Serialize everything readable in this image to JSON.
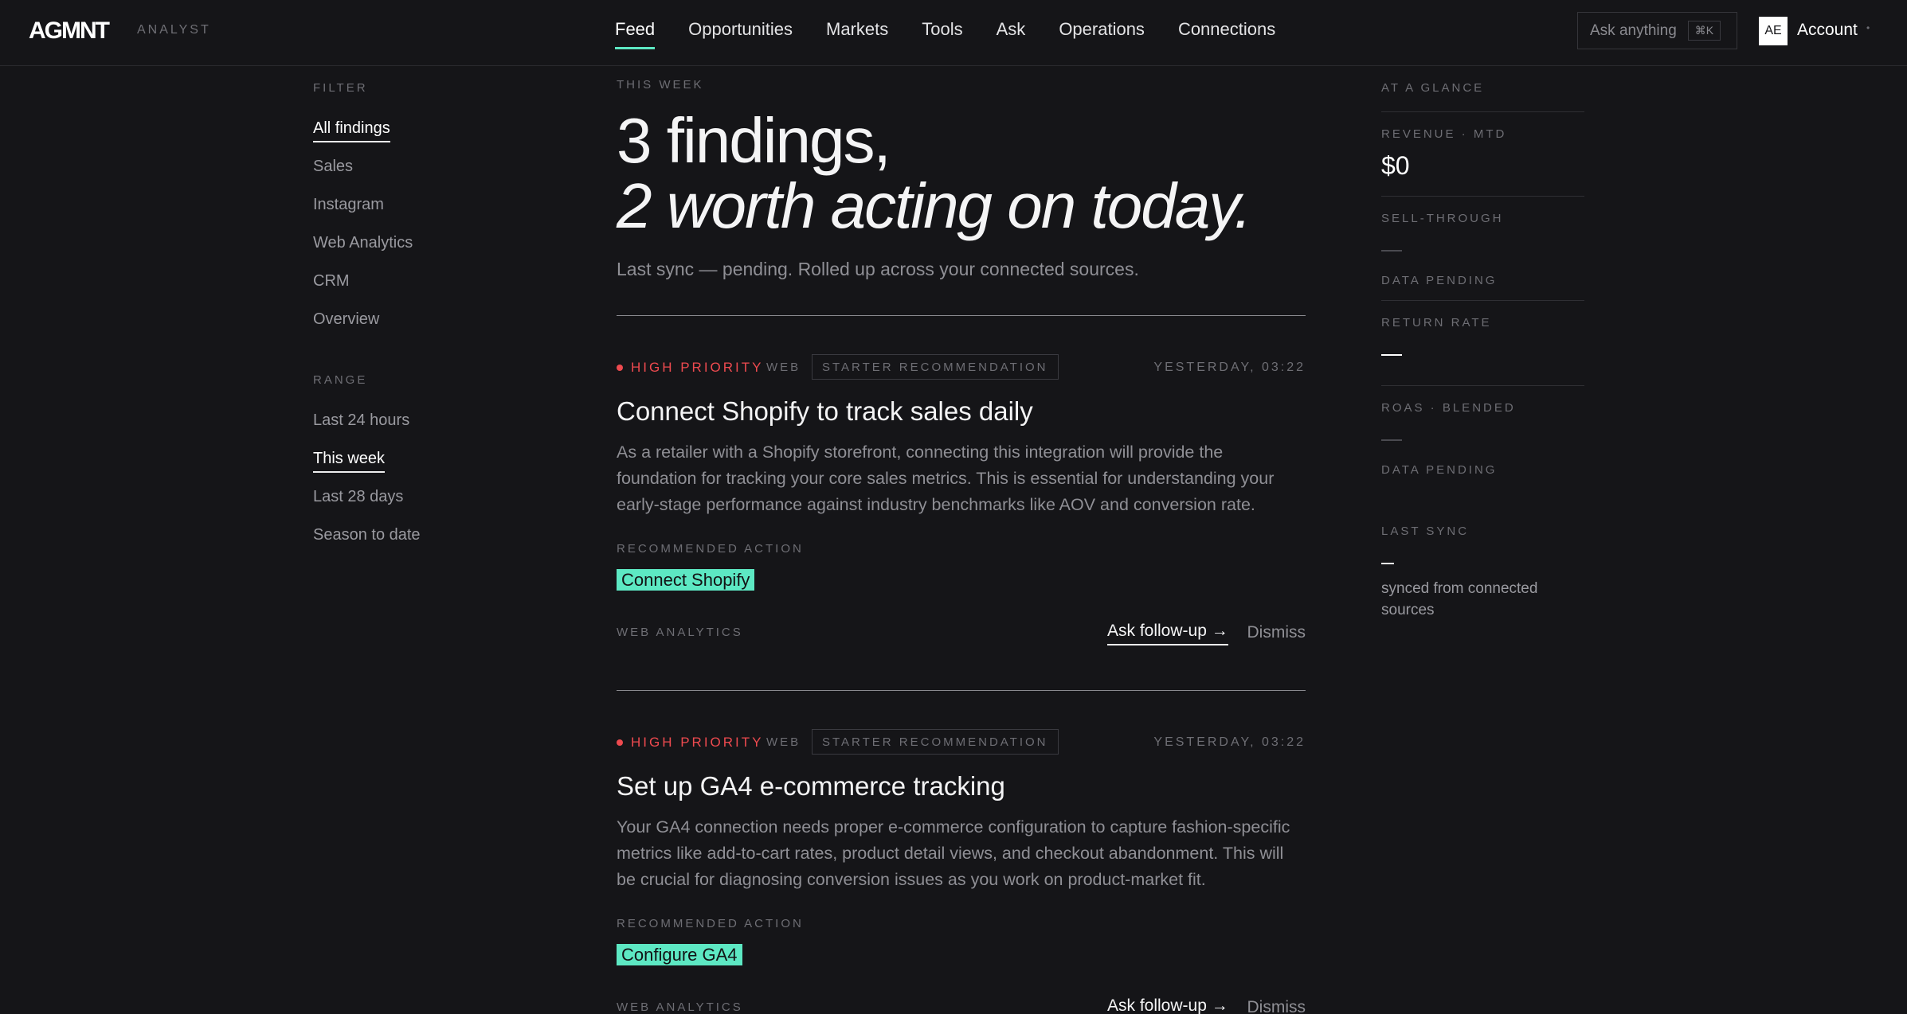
{
  "header": {
    "logo": "AGMNT",
    "logo_sub": "ANALYST",
    "nav": [
      "Feed",
      "Opportunities",
      "Markets",
      "Tools",
      "Ask",
      "Operations",
      "Connections"
    ],
    "active_nav": "Feed",
    "search_placeholder": "Ask anything",
    "search_shortcut": "⌘K",
    "avatar_initials": "AE",
    "account_label": "Account",
    "account_caret": "•"
  },
  "filter": {
    "label": "FILTER",
    "items": [
      "All findings",
      "Sales",
      "Instagram",
      "Web Analytics",
      "CRM",
      "Overview"
    ],
    "active": "All findings"
  },
  "range": {
    "label": "RANGE",
    "items": [
      "Last 24 hours",
      "This week",
      "Last 28 days",
      "Season to date"
    ],
    "active": "This week"
  },
  "main": {
    "kicker": "THIS WEEK",
    "hero_line1": "3 findings,",
    "hero_line2": "2 worth acting on today.",
    "sync_line": "Last sync — pending. Rolled up across your connected sources."
  },
  "findings": [
    {
      "priority": "HIGH PRIORITY",
      "source": "WEB",
      "tag": "STARTER RECOMMENDATION",
      "time": "YESTERDAY, 03:22",
      "title": "Connect Shopify to track sales daily",
      "body": "As a retailer with a Shopify storefront, connecting this integration will provide the foundation for tracking your core sales metrics. This is essential for understanding your early-stage performance against industry benchmarks like AOV and conversion rate.",
      "action_label": "RECOMMENDED ACTION",
      "action": "Connect Shopify",
      "footer_source": "WEB ANALYTICS",
      "followup": "Ask follow-up →",
      "dismiss": "Dismiss"
    },
    {
      "priority": "HIGH PRIORITY",
      "source": "WEB",
      "tag": "STARTER RECOMMENDATION",
      "time": "YESTERDAY, 03:22",
      "title": "Set up GA4 e-commerce tracking",
      "body": "Your GA4 connection needs proper e-commerce configuration to capture fashion-specific metrics like add-to-cart rates, product detail views, and checkout abandonment. This will be crucial for diagnosing conversion issues as you work on product-market fit.",
      "action_label": "RECOMMENDED ACTION",
      "action": "Configure GA4",
      "footer_source": "WEB ANALYTICS",
      "followup": "Ask follow-up →",
      "dismiss": "Dismiss"
    }
  ],
  "glance": {
    "label": "AT A GLANCE",
    "revenue_label": "REVENUE · MTD",
    "revenue_value": "$0",
    "sell_through_label": "SELL-THROUGH",
    "sell_through_status": "DATA PENDING",
    "return_rate_label": "RETURN RATE",
    "roas_label": "ROAS · BLENDED",
    "roas_status": "DATA PENDING",
    "last_sync_label": "LAST SYNC",
    "last_sync_note": "synced from connected sources"
  },
  "colors": {
    "background": "#151518",
    "accent": "#5de8c3",
    "priority": "#ee4a4f",
    "muted": "#6e6e74"
  }
}
